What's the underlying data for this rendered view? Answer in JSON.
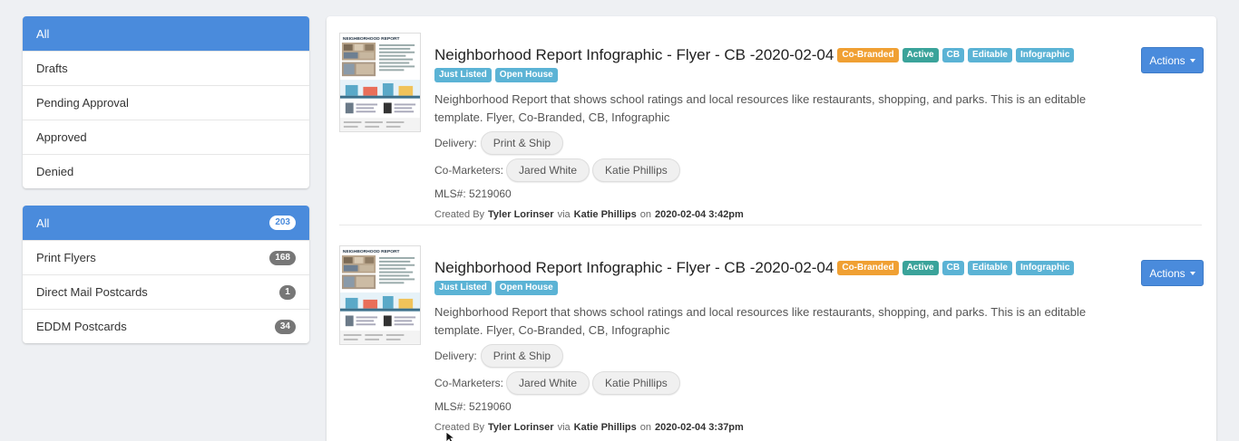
{
  "sidebar": {
    "status_filters": [
      {
        "label": "All",
        "active": true
      },
      {
        "label": "Drafts"
      },
      {
        "label": "Pending Approval"
      },
      {
        "label": "Approved"
      },
      {
        "label": "Denied"
      }
    ],
    "type_filters": [
      {
        "label": "All",
        "count": "203",
        "active": true
      },
      {
        "label": "Print Flyers",
        "count": "168"
      },
      {
        "label": "Direct Mail Postcards",
        "count": "1"
      },
      {
        "label": "EDDM Postcards",
        "count": "34"
      }
    ]
  },
  "items": [
    {
      "title": "Neighborhood Report Infographic - Flyer - CB -2020-02-04",
      "tags": [
        "Co-Branded",
        "Active",
        "CB",
        "Editable",
        "Infographic",
        "Just Listed",
        "Open House"
      ],
      "description": "Neighborhood Report that shows school ratings and local resources like restaurants, shopping, and parks. This is an editable template. Flyer, Co-Branded, CB, Infographic",
      "delivery_label": "Delivery:",
      "delivery": "Print & Ship",
      "comarketers_label": "Co-Marketers:",
      "comarketers": [
        "Jared White",
        "Katie Phillips"
      ],
      "mls": "MLS#: 5219060",
      "created_prefix": "Created By",
      "created_by": "Tyler Lorinser",
      "via_word": "via",
      "via": "Katie Phillips",
      "on_word": "on",
      "date": "2020-02-04 3:42pm",
      "actions_label": "Actions",
      "thumb_heading": "NEIGHBORHOOD REPORT"
    },
    {
      "title": "Neighborhood Report Infographic - Flyer - CB -2020-02-04",
      "tags": [
        "Co-Branded",
        "Active",
        "CB",
        "Editable",
        "Infographic",
        "Just Listed",
        "Open House"
      ],
      "description": "Neighborhood Report that shows school ratings and local resources like restaurants, shopping, and parks. This is an editable template. Flyer, Co-Branded, CB, Infographic",
      "delivery_label": "Delivery:",
      "delivery": "Print & Ship",
      "comarketers_label": "Co-Marketers:",
      "comarketers": [
        "Jared White",
        "Katie Phillips"
      ],
      "mls": "MLS#: 5219060",
      "created_prefix": "Created By",
      "created_by": "Tyler Lorinser",
      "via_word": "via",
      "via": "Katie Phillips",
      "on_word": "on",
      "date": "2020-02-04 3:37pm",
      "actions_label": "Actions",
      "thumb_heading": "NEIGHBORHOOD REPORT"
    }
  ],
  "tag_colors": {
    "Co-Branded": "#f0a033",
    "Active": "#3aa39a",
    "CB": "#5bb3d5",
    "Editable": "#5bb3d5",
    "Infographic": "#5bb3d5",
    "Just Listed": "#5bb3d5",
    "Open House": "#5bb3d5"
  },
  "colors": {
    "accent": "#4a8bdc",
    "page_bg": "#eef0f3"
  }
}
